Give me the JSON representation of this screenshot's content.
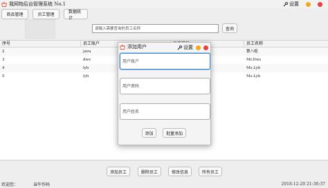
{
  "window": {
    "title": "我网物后台管理系统 No.1",
    "settings_label": "设置"
  },
  "nav": {
    "items": [
      "商品管理",
      "员工管理",
      "数据统计"
    ]
  },
  "search": {
    "placeholder": "请输入需要查询的员工名称",
    "button": "查询"
  },
  "table": {
    "columns": [
      "序号",
      "员工账户",
      "员工密码",
      "员工名称"
    ],
    "rows": [
      [
        "2",
        "java",
        "",
        "第八组"
      ],
      [
        "3",
        "dws",
        "",
        "Mr.Dws"
      ],
      [
        "4",
        "lyh",
        "",
        "Ms.Lyh"
      ],
      [
        "5",
        "lyh",
        "",
        "Ms.Lyh"
      ]
    ]
  },
  "dialog": {
    "title": "添加用户",
    "settings_label": "设置",
    "fields": {
      "account_placeholder": "用户账户",
      "password_placeholder": "用户密码",
      "name_placeholder": "用户姓名"
    },
    "buttons": {
      "add": "添加",
      "batch_add": "批量添加"
    }
  },
  "actions": [
    "添加员工",
    "删除员工",
    "修改信息",
    "所有员工"
  ],
  "status": {
    "welcome": "欢迎您：",
    "current": "当午作码",
    "datetime": "2018-12-20 21:30:37"
  },
  "colors": {
    "dot_yellow": "#f2a81b",
    "dot_red": "#ee3f3f",
    "focus": "#3a82c4"
  },
  "icons": {
    "logo": "shop-basket-icon",
    "settings": "wrench-icon"
  }
}
